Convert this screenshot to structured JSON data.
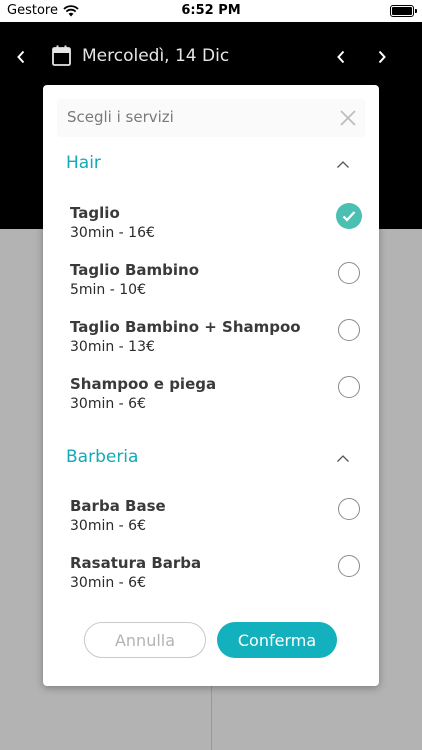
{
  "status_bar": {
    "carrier": "Gestore",
    "time": "6:52 PM"
  },
  "header": {
    "date": "Mercoledì, 14 Dic"
  },
  "modal": {
    "title": "Scegli i servizi",
    "sections": [
      {
        "title": "Hair",
        "services": [
          {
            "name": "Taglio",
            "meta": "30min - 16€",
            "selected": true
          },
          {
            "name": "Taglio Bambino",
            "meta": "5min - 10€",
            "selected": false
          },
          {
            "name": "Taglio Bambino + Shampoo",
            "meta": "30min - 13€",
            "selected": false
          },
          {
            "name": "Shampoo e piega",
            "meta": "30min - 6€",
            "selected": false
          }
        ]
      },
      {
        "title": "Barberia",
        "services": [
          {
            "name": "Barba Base",
            "meta": "30min - 6€",
            "selected": false
          },
          {
            "name": "Rasatura Barba",
            "meta": "30min - 6€",
            "selected": false
          }
        ]
      }
    ],
    "cancel_label": "Annulla",
    "confirm_label": "Conferma"
  },
  "colors": {
    "accent": "#13b1bd",
    "check": "#4bbfb2"
  }
}
